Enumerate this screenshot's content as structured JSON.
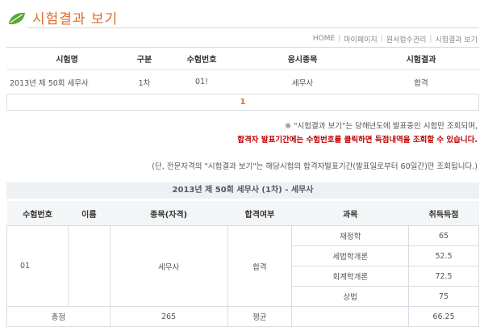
{
  "header": {
    "title": "시험결과 보기",
    "leaf_icon": "leaf-icon"
  },
  "breadcrumb": [
    "HOME",
    "마이페이지",
    "원서접수관리",
    "시험결과 보기"
  ],
  "list_table": {
    "headers": [
      "시험명",
      "구분",
      "수험번호",
      "응시종목",
      "시험결과"
    ],
    "rows": [
      [
        "2013년 제 50회 세무사",
        "1차",
        "01!",
        "세무사",
        "합격"
      ]
    ]
  },
  "pager": {
    "current": "1"
  },
  "notes": {
    "line1": "※ \"시험결과 보기\"는 당해년도에 발표중인 시험만 조회되며,",
    "line2": "합격자 발표기간에는 수험번호를 클릭하면 득점내역을 조회할 수 있습니다.",
    "line3": "(단, 전문자격의 \"시험결과 보기\"는 해당시험의 합격자발표기간(발표일로부터 60일간)만 조회됩니다.)"
  },
  "detail": {
    "title": "2013년 제 50회 세무사 (1차) - 세무사",
    "headers": [
      "수험번호",
      "이름",
      "종목(자격)",
      "합격여부",
      "과목",
      "취득득점"
    ],
    "exam_no": "01",
    "name": "",
    "qualification": "세무사",
    "pass": "합격",
    "subjects": [
      {
        "name": "재정학",
        "score": "65"
      },
      {
        "name": "세법학개론",
        "score": "52.5"
      },
      {
        "name": "회계학개론",
        "score": "72.5"
      },
      {
        "name": "상법",
        "score": "75"
      }
    ],
    "total_label": "총점",
    "total": "265",
    "avg_label": "평균",
    "avg": "66.25"
  },
  "colors": {
    "accent": "#e06a2a",
    "red": "#c00000"
  }
}
